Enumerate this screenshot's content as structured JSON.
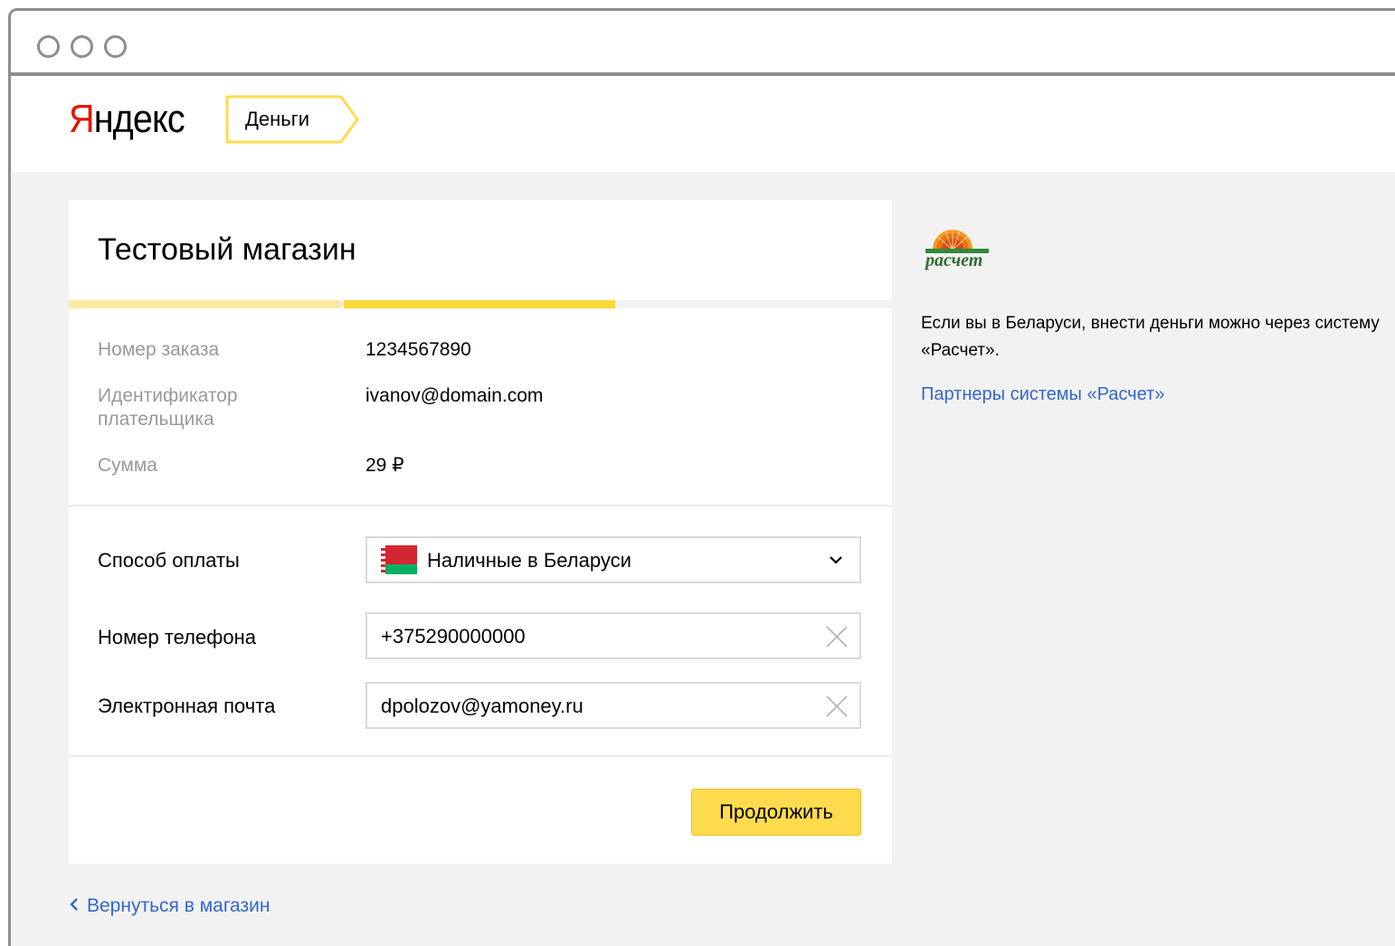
{
  "header": {
    "logo_first_letter": "Я",
    "logo_rest": "ндекс",
    "service_tag": "Деньги"
  },
  "order": {
    "shop_title": "Тестовый магазин",
    "progress_steps_completed": 2,
    "rows": [
      {
        "label": "Номер заказа",
        "value": "1234567890"
      },
      {
        "label": "Идентификатор\nплательщика",
        "value": "ivanov@domain.com"
      },
      {
        "label": "Сумма",
        "value": "29 ₽"
      }
    ]
  },
  "form": {
    "payment_method_label": "Способ оплаты",
    "payment_method_value": "Наличные в Беларуси",
    "phone_label": "Номер телефона",
    "phone_value": "+375290000000",
    "email_label": "Электронная почта",
    "email_value": "dpolozov@yamoney.ru",
    "continue_label": "Продолжить"
  },
  "back_link": "Вернуться в магазин",
  "sidebar": {
    "logo_text": "расчет",
    "description": "Если вы в Беларуси, внести деньги можно через систему «Расчет».",
    "partners_link": "Партнеры системы «Расчет»"
  },
  "colors": {
    "accent_yellow": "#ffdb4d",
    "logo_red": "#e61400",
    "link_blue": "#3366cc",
    "step_done": "#fde9a0",
    "step_current": "#fcd939"
  }
}
